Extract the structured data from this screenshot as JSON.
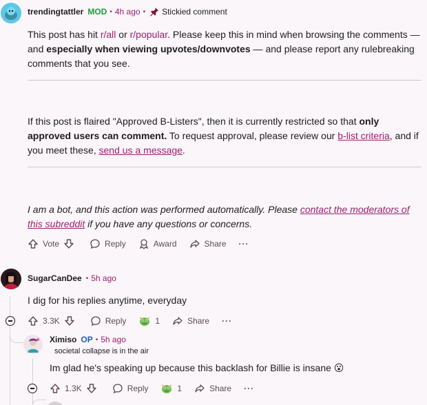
{
  "top_comment": {
    "username": "trendingtattler",
    "badge": "MOD",
    "time": "4h ago",
    "stickied_label": "Stickied comment",
    "p1": {
      "t1": "This post has hit ",
      "link_all": "r/all",
      "t2": " or ",
      "link_popular": "r/popular",
      "t3": ". Please keep this in mind when browsing the comments — and ",
      "bold": "especially when viewing upvotes/downvotes",
      "t4": " — and please report any rulebreaking comments that you see."
    },
    "p2": {
      "t1": "If this post is flaired \"Approved B-Listers\", then it is currently restricted so that ",
      "bold": "only approved users can comment.",
      "t2": " To request approval, please review our ",
      "link_criteria": "b-list criteria",
      "t3": ", and if you meet these, ",
      "link_message": "send us a message",
      "t4": "."
    },
    "p3": {
      "t1": "I am a bot, and this action was performed automatically. Please ",
      "link_contact": "contact the moderators of this subreddit",
      "t2": " if you have any questions or concerns."
    },
    "actions": {
      "vote": "Vote",
      "reply": "Reply",
      "award": "Award",
      "share": "Share",
      "more": "···"
    }
  },
  "comment1": {
    "username": "SugarCanDee",
    "time": "5h ago",
    "text": "I dig for his replies anytime, everyday",
    "votes": "3.3K",
    "reply": "Reply",
    "award_count": "1",
    "share": "Share",
    "more": "···"
  },
  "comment2": {
    "username": "Ximiso",
    "badge": "OP",
    "time": "5h ago",
    "flair": "societal collapse is in the air",
    "text": "Im glad he's speaking up because this backlash for Billie is insane 😮",
    "votes": "1.3K",
    "reply": "Reply",
    "award_count": "1",
    "share": "Share",
    "more": "···"
  },
  "colors": {
    "accent": "#9b1f6e",
    "mod": "#1e9c3a",
    "op": "#1a5cd8",
    "background": "#fbf6fa"
  }
}
